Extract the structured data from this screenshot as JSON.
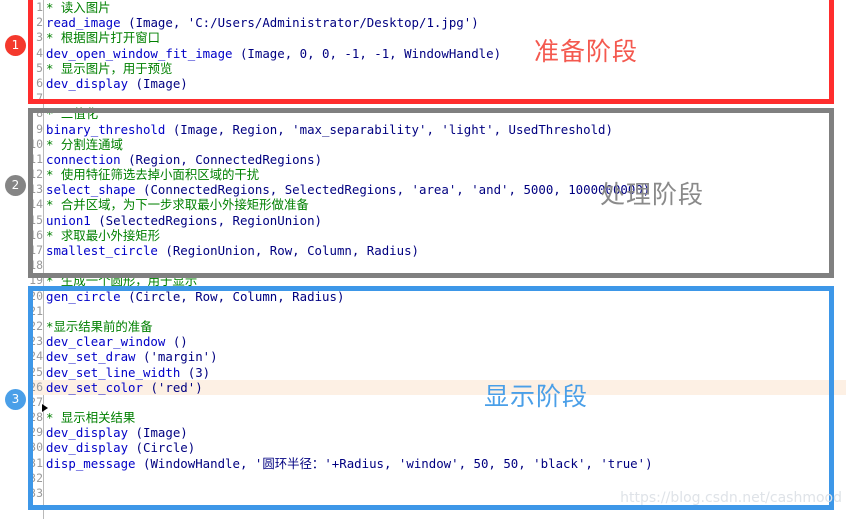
{
  "app": {
    "kind": "halcon-code-editor-screenshot",
    "watermark": "https://blog.csdn.net/cashmood"
  },
  "colors": {
    "stage1_accent": "#ff2d2d",
    "stage2_accent": "#808080",
    "stage3_accent": "#3d97e8",
    "comment": "#008000",
    "keyword": "#0000c8",
    "plain": "#000080",
    "current_line_bg": "#fdf0e4",
    "background": "#ffffff"
  },
  "stages": [
    {
      "number": "1",
      "label": "准备阶段"
    },
    {
      "number": "2",
      "label": "处理阶段"
    },
    {
      "number": "3",
      "label": "显示阶段"
    }
  ],
  "code": [
    {
      "num": "1",
      "text": "* 读入图片",
      "type": "comment",
      "highlight": false
    },
    {
      "num": "2",
      "text": "read_image (Image, 'C:/Users/Administrator/Desktop/1.jpg')",
      "type": "code",
      "highlight": false
    },
    {
      "num": "3",
      "text": "* 根据图片打开窗口",
      "type": "comment",
      "highlight": false
    },
    {
      "num": "4",
      "text": "dev_open_window_fit_image (Image, 0, 0, -1, -1, WindowHandle)",
      "type": "code",
      "highlight": false
    },
    {
      "num": "5",
      "text": "* 显示图片，用于预览",
      "type": "comment",
      "highlight": false
    },
    {
      "num": "6",
      "text": "dev_display (Image)",
      "type": "code",
      "highlight": false
    },
    {
      "num": "7",
      "text": "",
      "type": "blank",
      "highlight": false
    },
    {
      "num": "8",
      "text": "* 二值化",
      "type": "comment",
      "highlight": false
    },
    {
      "num": "9",
      "text": "binary_threshold (Image, Region, 'max_separability', 'light', UsedThreshold)",
      "type": "code",
      "highlight": false
    },
    {
      "num": "10",
      "text": "* 分割连通域",
      "type": "comment",
      "highlight": false
    },
    {
      "num": "11",
      "text": "connection (Region, ConnectedRegions)",
      "type": "code",
      "highlight": false
    },
    {
      "num": "12",
      "text": "* 使用特征筛选去掉小面积区域的干扰",
      "type": "comment",
      "highlight": false
    },
    {
      "num": "13",
      "text": "select_shape (ConnectedRegions, SelectedRegions, 'area', 'and', 5000, 1000000000)",
      "type": "code",
      "highlight": false
    },
    {
      "num": "14",
      "text": "* 合并区域，为下一步求取最小外接矩形做准备",
      "type": "comment",
      "highlight": false
    },
    {
      "num": "15",
      "text": "union1 (SelectedRegions, RegionUnion)",
      "type": "code",
      "highlight": false
    },
    {
      "num": "16",
      "text": "* 求取最小外接矩形",
      "type": "comment",
      "highlight": false
    },
    {
      "num": "17",
      "text": "smallest_circle (RegionUnion, Row, Column, Radius)",
      "type": "code",
      "highlight": false
    },
    {
      "num": "18",
      "text": "",
      "type": "blank",
      "highlight": false
    },
    {
      "num": "19",
      "text": "* 生成一个圆形，用于显示",
      "type": "comment",
      "highlight": false
    },
    {
      "num": "20",
      "text": "gen_circle (Circle, Row, Column, Radius)",
      "type": "code",
      "highlight": false
    },
    {
      "num": "21",
      "text": "",
      "type": "blank",
      "highlight": false
    },
    {
      "num": "22",
      "text": "*显示结果前的准备",
      "type": "comment",
      "highlight": false
    },
    {
      "num": "23",
      "text": "dev_clear_window ()",
      "type": "code",
      "highlight": false
    },
    {
      "num": "24",
      "text": "dev_set_draw ('margin')",
      "type": "code",
      "highlight": false
    },
    {
      "num": "25",
      "text": "dev_set_line_width (3)",
      "type": "code",
      "highlight": false
    },
    {
      "num": "26",
      "text": "dev_set_color ('red')",
      "type": "code",
      "highlight": true
    },
    {
      "num": "27",
      "text": "",
      "type": "blank",
      "highlight": false
    },
    {
      "num": "28",
      "text": "* 显示相关结果",
      "type": "comment",
      "highlight": false
    },
    {
      "num": "29",
      "text": "dev_display (Image)",
      "type": "code",
      "highlight": false
    },
    {
      "num": "30",
      "text": "dev_display (Circle)",
      "type": "code",
      "highlight": false
    },
    {
      "num": "31",
      "text": "disp_message (WindowHandle, '圆环半径：'+Radius, 'window', 50, 50, 'black', 'true')",
      "type": "code",
      "highlight": false
    },
    {
      "num": "32",
      "text": "",
      "type": "blank",
      "highlight": false
    },
    {
      "num": "33",
      "text": "",
      "type": "blank",
      "highlight": false
    }
  ]
}
